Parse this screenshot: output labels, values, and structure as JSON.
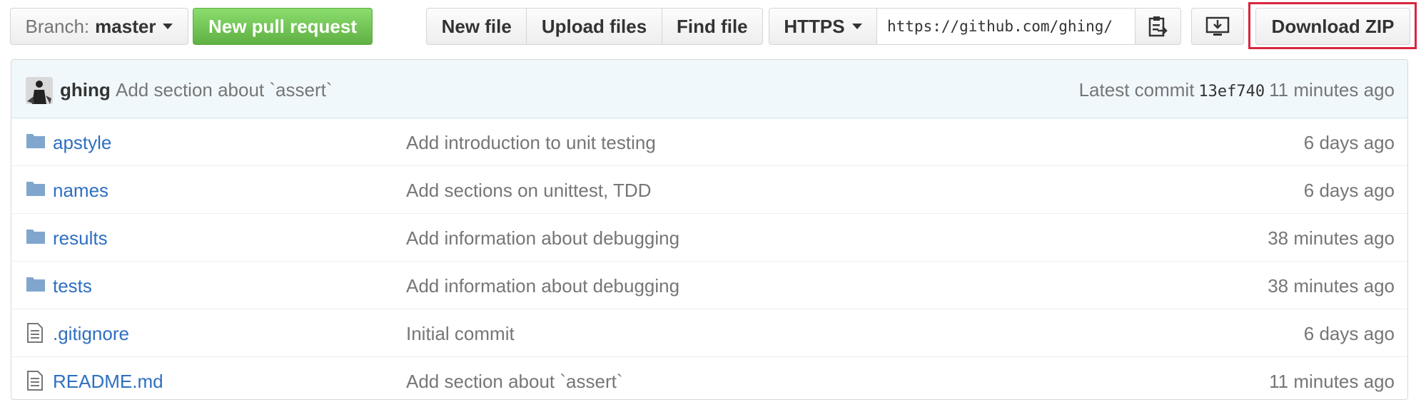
{
  "toolbar": {
    "branch_label": "Branch:",
    "branch_value": "master",
    "new_pr": "New pull request",
    "new_file": "New file",
    "upload_files": "Upload files",
    "find_file": "Find file",
    "protocol": "HTTPS",
    "clone_url": "https://github.com/ghing/",
    "download_zip": "Download ZIP"
  },
  "commit": {
    "author": "ghing",
    "message": "Add section about `assert`",
    "latest_label": "Latest commit",
    "sha": "13ef740",
    "age": "11 minutes ago"
  },
  "files": [
    {
      "type": "folder",
      "name": "apstyle",
      "message": "Add introduction to unit testing",
      "age": "6 days ago"
    },
    {
      "type": "folder",
      "name": "names",
      "message": "Add sections on unittest, TDD",
      "age": "6 days ago"
    },
    {
      "type": "folder",
      "name": "results",
      "message": "Add information about debugging",
      "age": "38 minutes ago"
    },
    {
      "type": "folder",
      "name": "tests",
      "message": "Add information about debugging",
      "age": "38 minutes ago"
    },
    {
      "type": "file",
      "name": ".gitignore",
      "message": "Initial commit",
      "age": "6 days ago"
    },
    {
      "type": "file",
      "name": "README.md",
      "message": "Add section about `assert`",
      "age": "11 minutes ago"
    }
  ],
  "colors": {
    "link": "#2e6fc1",
    "green_button": "#60b044",
    "highlight": "#d7263d",
    "folder_icon": "#80a6cd"
  },
  "icons": {
    "folder": "folder-icon",
    "file": "file-icon",
    "clipboard": "clipboard-icon",
    "desktop": "desktop-download-icon"
  }
}
